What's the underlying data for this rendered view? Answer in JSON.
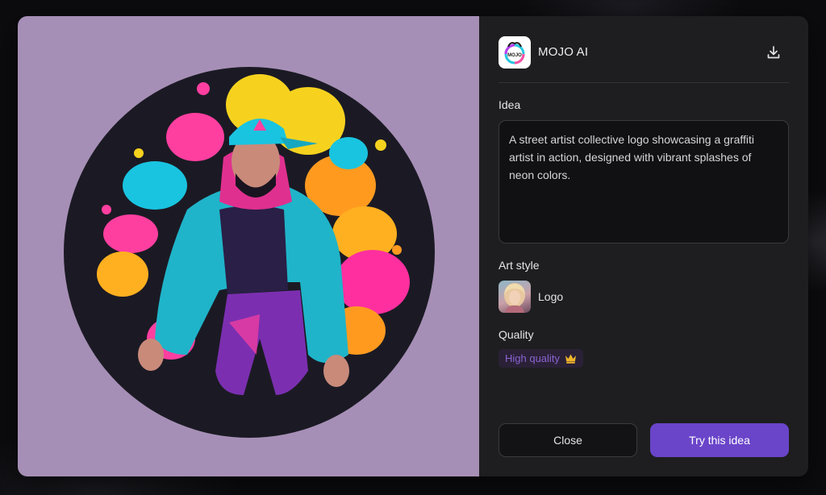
{
  "brand": {
    "name": "MOJO AI",
    "logo_text": "MOJO"
  },
  "header": {
    "download_icon": "download-icon"
  },
  "idea": {
    "label": "Idea",
    "text": "A street artist collective logo showcasing a graffiti artist in action, designed with vibrant splashes of neon colors."
  },
  "art_style": {
    "label": "Art style",
    "value": "Logo"
  },
  "quality": {
    "label": "Quality",
    "value": "High quality",
    "icon": "crown-icon"
  },
  "actions": {
    "close_label": "Close",
    "try_label": "Try this idea"
  },
  "colors": {
    "accent": "#6a45c9",
    "preview_bg": "#a68fb6",
    "panel_bg": "#1e1e20",
    "quality_text": "#8a63d2",
    "crown": "#f0b429"
  }
}
